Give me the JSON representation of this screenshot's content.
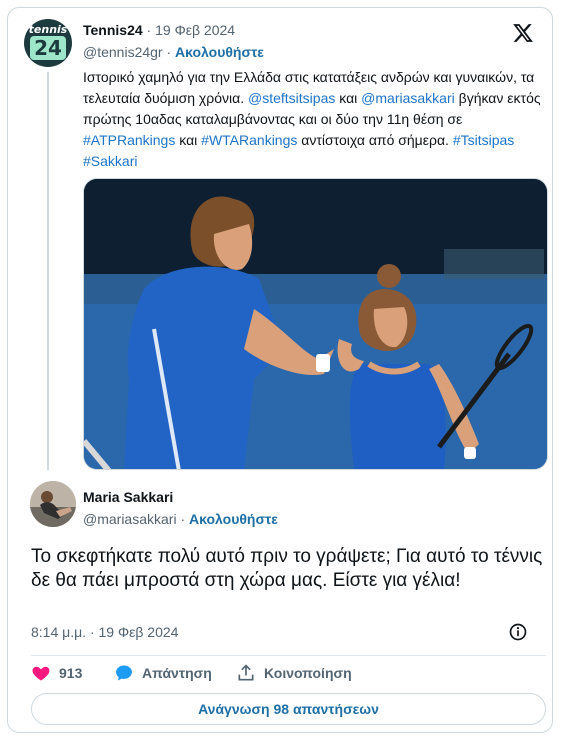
{
  "tweet": {
    "author_name": "Tennis24",
    "date": "19 Φεβ 2024",
    "handle": "@tennis24gr",
    "follow_label": "Ακολουθήστε",
    "avatar": {
      "line1": "tennis",
      "line2": "24"
    },
    "text_parts": [
      {
        "text": "Ιστορικό χαμηλό για την Ελλάδα στις κατατάξεις ανδρών και γυναικών, τα τελευταία δυόμιση χρόνια. ",
        "link": false
      },
      {
        "text": "@steftsitsipas",
        "link": true
      },
      {
        "text": " και ",
        "link": false
      },
      {
        "text": "@mariasakkari",
        "link": true
      },
      {
        "text": "  βγήκαν εκτός πρώτης 10αδας καταλαμβάνοντας και οι δύο την 11η θέση σε ",
        "link": false
      },
      {
        "text": "#ATPRankings",
        "link": true
      },
      {
        "text": " και ",
        "link": false
      },
      {
        "text": "#WTARankings",
        "link": true
      },
      {
        "text": " αντίστοιχα από σήμερα. ",
        "link": false
      },
      {
        "text": "#Tsitsipas",
        "link": true
      },
      {
        "text": " ",
        "link": false
      },
      {
        "text": "#Sakkari",
        "link": true
      }
    ]
  },
  "reply": {
    "author_name": "Maria Sakkari",
    "handle": "@mariasakkari",
    "separator": "·",
    "follow_label": "Ακολουθήστε",
    "text": "Το σκεφτήκατε πολύ αυτό πριν το γράψετε; Για αυτό το τέννις δε θα πάει μπροστά στη χώρα μας. Είστε για γέλια!",
    "timestamp": "8:14 μ.μ. · 19 Φεβ 2024"
  },
  "actions": {
    "likes": "913",
    "reply_label": "Απάντηση",
    "share_label": "Κοινοποίηση",
    "read_replies": "Ανάγνωση 98 απαντήσεων"
  },
  "colors": {
    "link": "#1d74c8",
    "like": "#f91880",
    "reply_bubble": "#1d9bf0",
    "muted": "#536471"
  },
  "icons": [
    "x-logo-icon",
    "info-icon",
    "heart-icon",
    "reply-icon",
    "share-icon"
  ]
}
